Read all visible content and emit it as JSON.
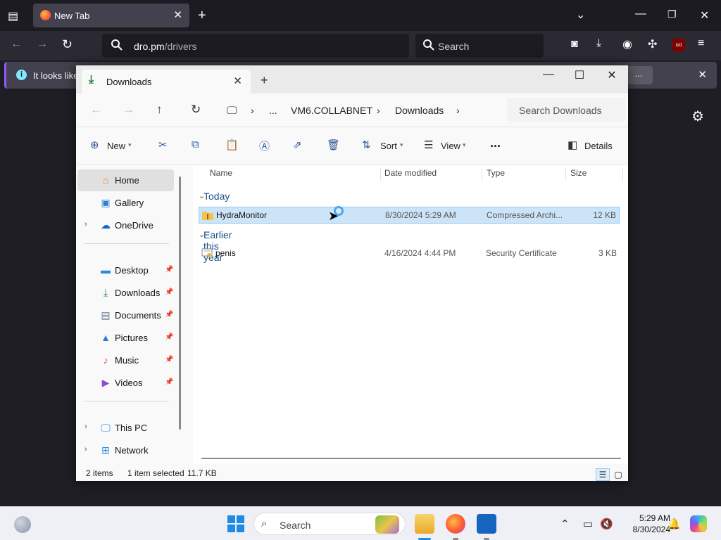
{
  "browser": {
    "tab_title": "New Tab",
    "url_host": "dro.pm",
    "url_path": "/drivers",
    "search_placeholder": "Search",
    "infobar_text": "It looks like",
    "infobar_button": "..."
  },
  "explorer": {
    "tab_title": "Downloads",
    "breadcrumb": [
      "...",
      "VM6.COLLABNET",
      "Downloads"
    ],
    "search_placeholder": "Search Downloads",
    "commands": {
      "new": "New",
      "sort": "Sort",
      "view": "View",
      "more": "...",
      "details": "Details"
    },
    "nav": {
      "top": [
        {
          "label": "Home",
          "icon": "home-icon"
        },
        {
          "label": "Gallery",
          "icon": "gallery-icon"
        },
        {
          "label": "OneDrive",
          "icon": "cloud-icon"
        }
      ],
      "quick_access": [
        {
          "label": "Desktop",
          "icon": "desktop-icon"
        },
        {
          "label": "Downloads",
          "icon": "download-icon"
        },
        {
          "label": "Documents",
          "icon": "document-icon"
        },
        {
          "label": "Pictures",
          "icon": "picture-icon"
        },
        {
          "label": "Music",
          "icon": "music-icon"
        },
        {
          "label": "Videos",
          "icon": "video-icon"
        }
      ],
      "bottom": [
        {
          "label": "This PC",
          "icon": "computer-icon"
        },
        {
          "label": "Network",
          "icon": "network-icon"
        }
      ]
    },
    "columns": [
      "Name",
      "Date modified",
      "Type",
      "Size"
    ],
    "groups": [
      {
        "label": "Today",
        "files": [
          {
            "name": "HydraMonitor",
            "date": "8/30/2024 5:29 AM",
            "type": "Compressed Archi...",
            "size": "12 KB",
            "selected": true
          }
        ]
      },
      {
        "label": "Earlier this year",
        "files": [
          {
            "name": "penis",
            "date": "4/16/2024 4:44 PM",
            "type": "Security Certificate",
            "size": "3 KB",
            "selected": false
          }
        ]
      }
    ],
    "status": {
      "items": "2 items",
      "selected": "1 item selected",
      "size": "11.7 KB"
    }
  },
  "taskbar": {
    "search_label": "Search",
    "time": "5:29 AM",
    "date": "8/30/2024"
  },
  "colors": {
    "accent": "#1f8ae6",
    "selection": "#cce4f7",
    "firefox_bg": "#2b2a33"
  }
}
